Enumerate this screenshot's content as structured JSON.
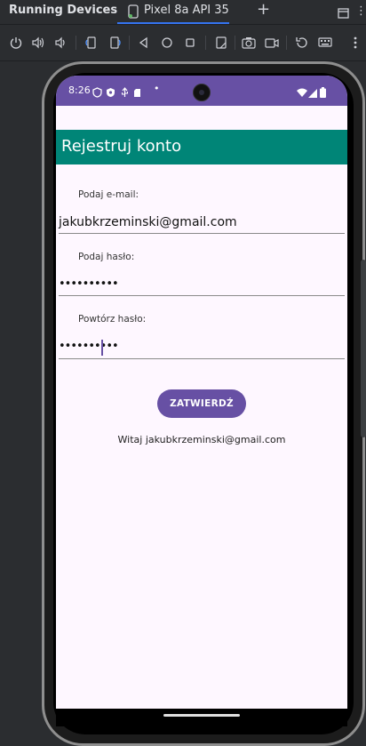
{
  "ide": {
    "panel_title": "Running Devices",
    "tab_label": "Pixel 8a API 35",
    "new_tab_symbol": "+",
    "more_symbol": "⋮"
  },
  "toolbar": {
    "icons": [
      "power-icon",
      "volume-up-icon",
      "volume-down-icon",
      "rotate-left-icon",
      "rotate-right-icon",
      "back-icon",
      "home-icon",
      "overview-icon",
      "fold-icon",
      "screenshot-icon",
      "record-icon",
      "reset-icon",
      "keyboard-icon"
    ]
  },
  "status": {
    "time": "8:26",
    "dot": "•"
  },
  "app": {
    "title": "Rejestruj konto",
    "email_label": "Podaj e-mail:",
    "email_value": "jakubkrzeminski@gmail.com",
    "password_label": "Podaj hasło:",
    "password_value": "••••••••••",
    "repeat_label": "Powtórz hasło:",
    "repeat_value": "••••••••••",
    "confirm_label": "ZATWIERDŹ",
    "welcome_text": "Witaj jakubkrzeminski@gmail.com"
  },
  "colors": {
    "status_bar": "#6750a4",
    "app_bar": "#008577",
    "button": "#6750a4",
    "screen_bg": "#fef7ff"
  }
}
